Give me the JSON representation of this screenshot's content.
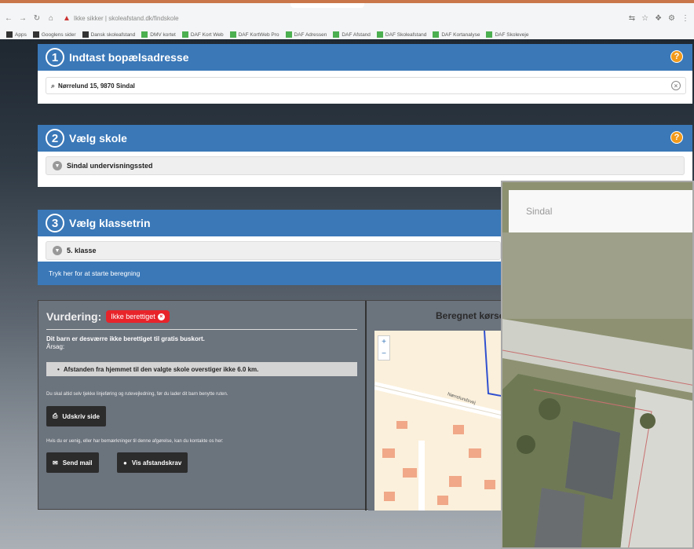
{
  "browser": {
    "url": "Ikke sikker | skoleafstand.dk/findskole",
    "bookmarks": [
      "Apps",
      "Googlens sider",
      "Dansk skoleafstand",
      "DMV kortet",
      "DAF Kort Web",
      "DAF KortWeb Pro",
      "DAF Adressen",
      "DAF Afstand",
      "DAF Skoleafstand",
      "DAF Kortanalyse",
      "DAF Skoleveje"
    ]
  },
  "steps": [
    {
      "number": "1",
      "title": "Indtast bopælsadresse",
      "value": "Nørrelund 15, 9870 Sindal"
    },
    {
      "number": "2",
      "title": "Vælg skole",
      "value": "Sindal undervisningssted"
    },
    {
      "number": "3",
      "title": "Vælg klassetrin",
      "value": "5. klasse"
    }
  ],
  "help_label": "?",
  "calc_prompt": "Tryk her for at starte beregning",
  "result": {
    "label": "Vurdering:",
    "badge": "Ikke berettiget",
    "line1": "Dit barn er desværre ikke berettiget til gratis buskort.",
    "line2": "Årsag:",
    "reason": "Afstanden fra hjemmet til den valgte skole overstiger ikke 6.0 km.",
    "note1": "Du skal altid selv tjekke linjeføring og rutevejledning, før du lader dit barn benytte ruten.",
    "button_print": "Udskriv side",
    "note2": "Hvis du er uenig, eller har bemærkninger til denne afgørelse, kan du kontakte os her:",
    "button_mail": "Send mail",
    "button_afstand": "Vis afstandskrav"
  },
  "map_title": "Beregnet kørselsrute",
  "map_road_label": "Nørrelundsvej",
  "photo_label": "Sindal",
  "colors": {
    "accent": "#3a78b8",
    "danger": "#e8242b",
    "help": "#f29a1b"
  }
}
